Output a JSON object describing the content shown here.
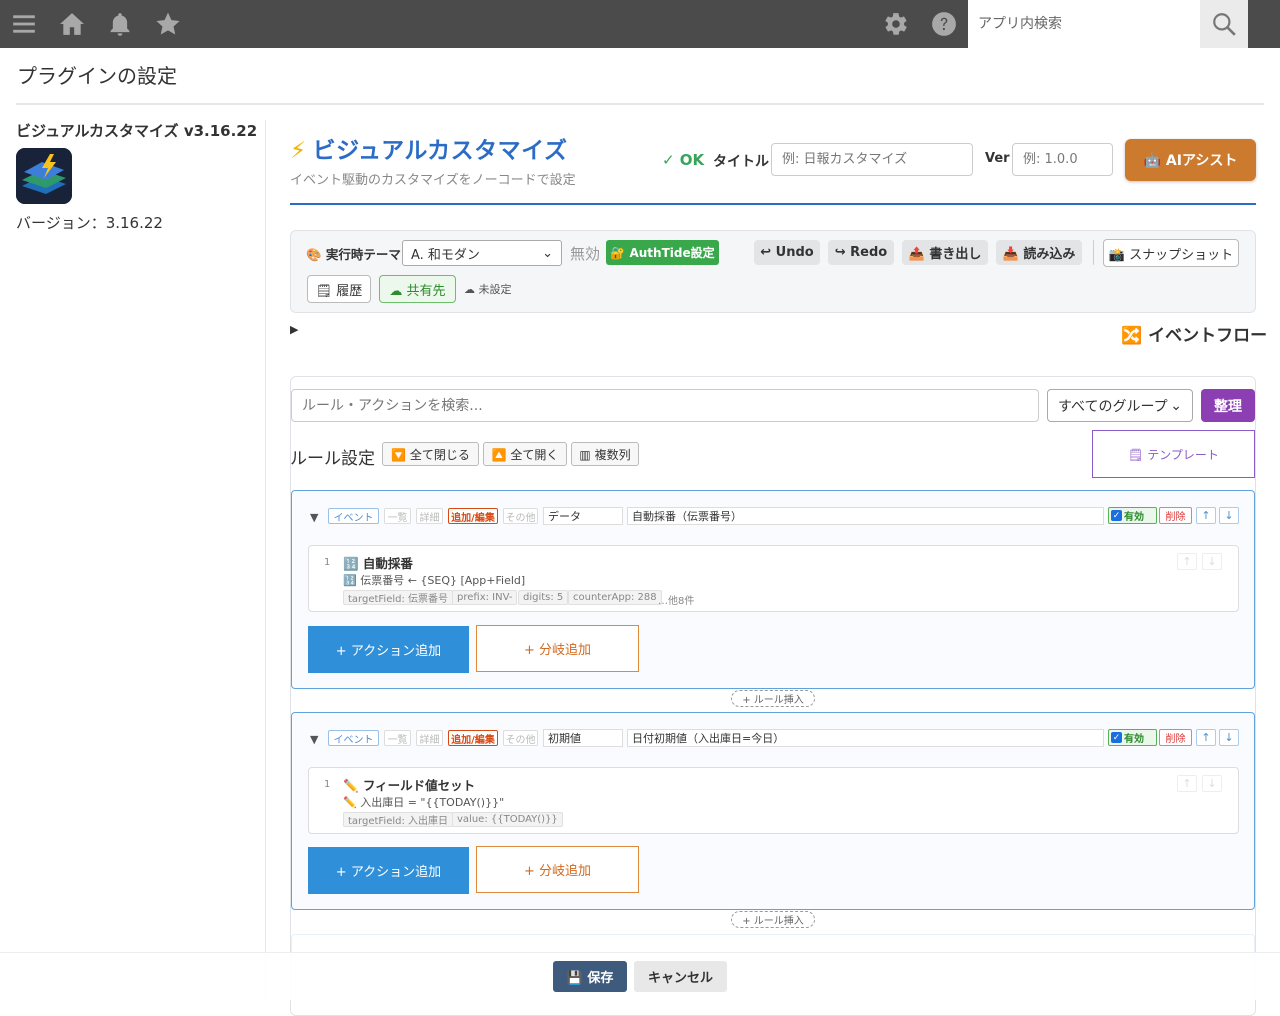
{
  "topbar": {
    "search_placeholder": "アプリ内検索"
  },
  "page": {
    "title": "プラグインの設定"
  },
  "sidebar": {
    "plugin_name": "ビジュアルカスタマイズ v3.16.22",
    "version_text": "バージョン：3.16.22"
  },
  "header": {
    "title": "ビジュアルカスタマイズ",
    "subtitle": "イベント駆動のカスタマイズをノーコードで設定",
    "status": "✓ OK",
    "title_label": "タイトル",
    "title_placeholder": "例: 日報カスタマイズ",
    "ver_label": "Ver",
    "ver_placeholder": "例: 1.0.0",
    "ai_button": "🤖 AIアシスト",
    "accent": "#2a6cc6"
  },
  "toolbar": {
    "theme_label": "🎨 実行時テーマ",
    "theme_value": "A. 和モダン",
    "disabled_text": "無効",
    "authtide": "🔐 AuthTide設定",
    "undo": "↩ Undo",
    "redo": "↪ Redo",
    "export": "📤 書き出し",
    "import": "📥 読み込み",
    "snapshot": "📸 スナップショット",
    "history": "🗒 履歴",
    "share": "☁ 共有先",
    "unset": "☁ 未設定"
  },
  "eventflow": {
    "label": "🔀 イベントフロー"
  },
  "rules": {
    "search_placeholder": "ルール・アクションを検索...",
    "group_select": "すべてのグループ",
    "organize_button": "整理",
    "title": "ルール設定",
    "collapse_all": "🔽 全て閉じる",
    "expand_all": "🔼 全て開く",
    "multi_column": "▥ 複数列",
    "template": "🗒 テンプレート",
    "insert_rule": "+ ルール挿入",
    "items": [
      {
        "chips": [
          "イベント",
          "一覧",
          "詳細",
          "追加/編集",
          "その他"
        ],
        "category": "データ",
        "name": "自動採番（伝票番号）",
        "enabled_label": "有効",
        "delete_label": "削除",
        "action": {
          "num": "1",
          "title": "🔢 自動採番",
          "desc": "🔢 伝票番号 ← {SEQ} [App+Field]",
          "tags": [
            "targetField: 伝票番号",
            "prefix: INV-",
            "digits: 5",
            "counterApp: 288"
          ],
          "more": "…他8件"
        },
        "add_action": "+ アクション追加",
        "add_branch": "+ 分岐追加"
      },
      {
        "chips": [
          "イベント",
          "一覧",
          "詳細",
          "追加/編集",
          "その他"
        ],
        "category": "初期値",
        "name": "日付初期値（入出庫日=今日）",
        "enabled_label": "有効",
        "delete_label": "削除",
        "action": {
          "num": "1",
          "title": "✏️ フィールド値セット",
          "desc": "✏️ 入出庫日 = \"{{TODAY()}}\"",
          "tags": [
            "targetField: 入出庫日",
            "value: {{TODAY()}}"
          ],
          "more": ""
        },
        "add_action": "+ アクション追加",
        "add_branch": "+ 分岐追加"
      }
    ]
  },
  "footer": {
    "save": "💾 保存",
    "cancel": "キャンセル"
  }
}
